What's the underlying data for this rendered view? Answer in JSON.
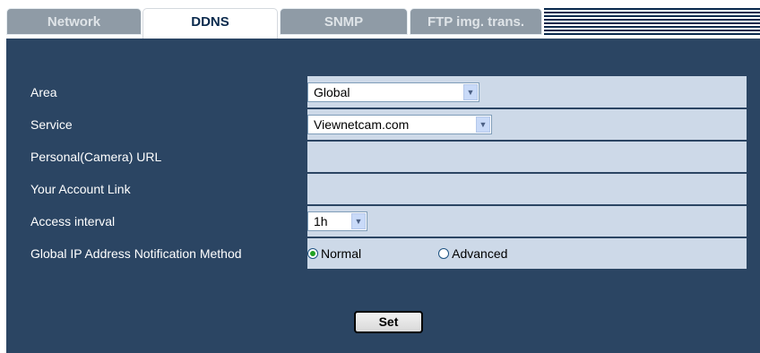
{
  "tabs": [
    {
      "label": "Network",
      "active": false
    },
    {
      "label": "DDNS",
      "active": true
    },
    {
      "label": "SNMP",
      "active": false
    },
    {
      "label": "FTP img. trans.",
      "active": false
    }
  ],
  "rows": {
    "area": {
      "label": "Area",
      "value": "Global"
    },
    "service": {
      "label": "Service",
      "value": "Viewnetcam.com"
    },
    "personal_url": {
      "label": "Personal(Camera) URL",
      "value": ""
    },
    "account_link": {
      "label": "Your Account Link",
      "value": ""
    },
    "access_interval": {
      "label": "Access interval",
      "value": "1h"
    },
    "notification": {
      "label": "Global IP Address Notification Method",
      "options": [
        "Normal",
        "Advanced"
      ],
      "selected": "Normal"
    }
  },
  "set_label": "Set",
  "colors": {
    "panel": "#2b4563",
    "value_cell": "#cdd9e8",
    "tab_inactive": "#8f9ba6",
    "tab_active_text": "#0b2a4d",
    "radio_selected": "#21a121"
  },
  "icons": {
    "dropdown": "chevron-down-icon",
    "radio": "radio-icon"
  }
}
